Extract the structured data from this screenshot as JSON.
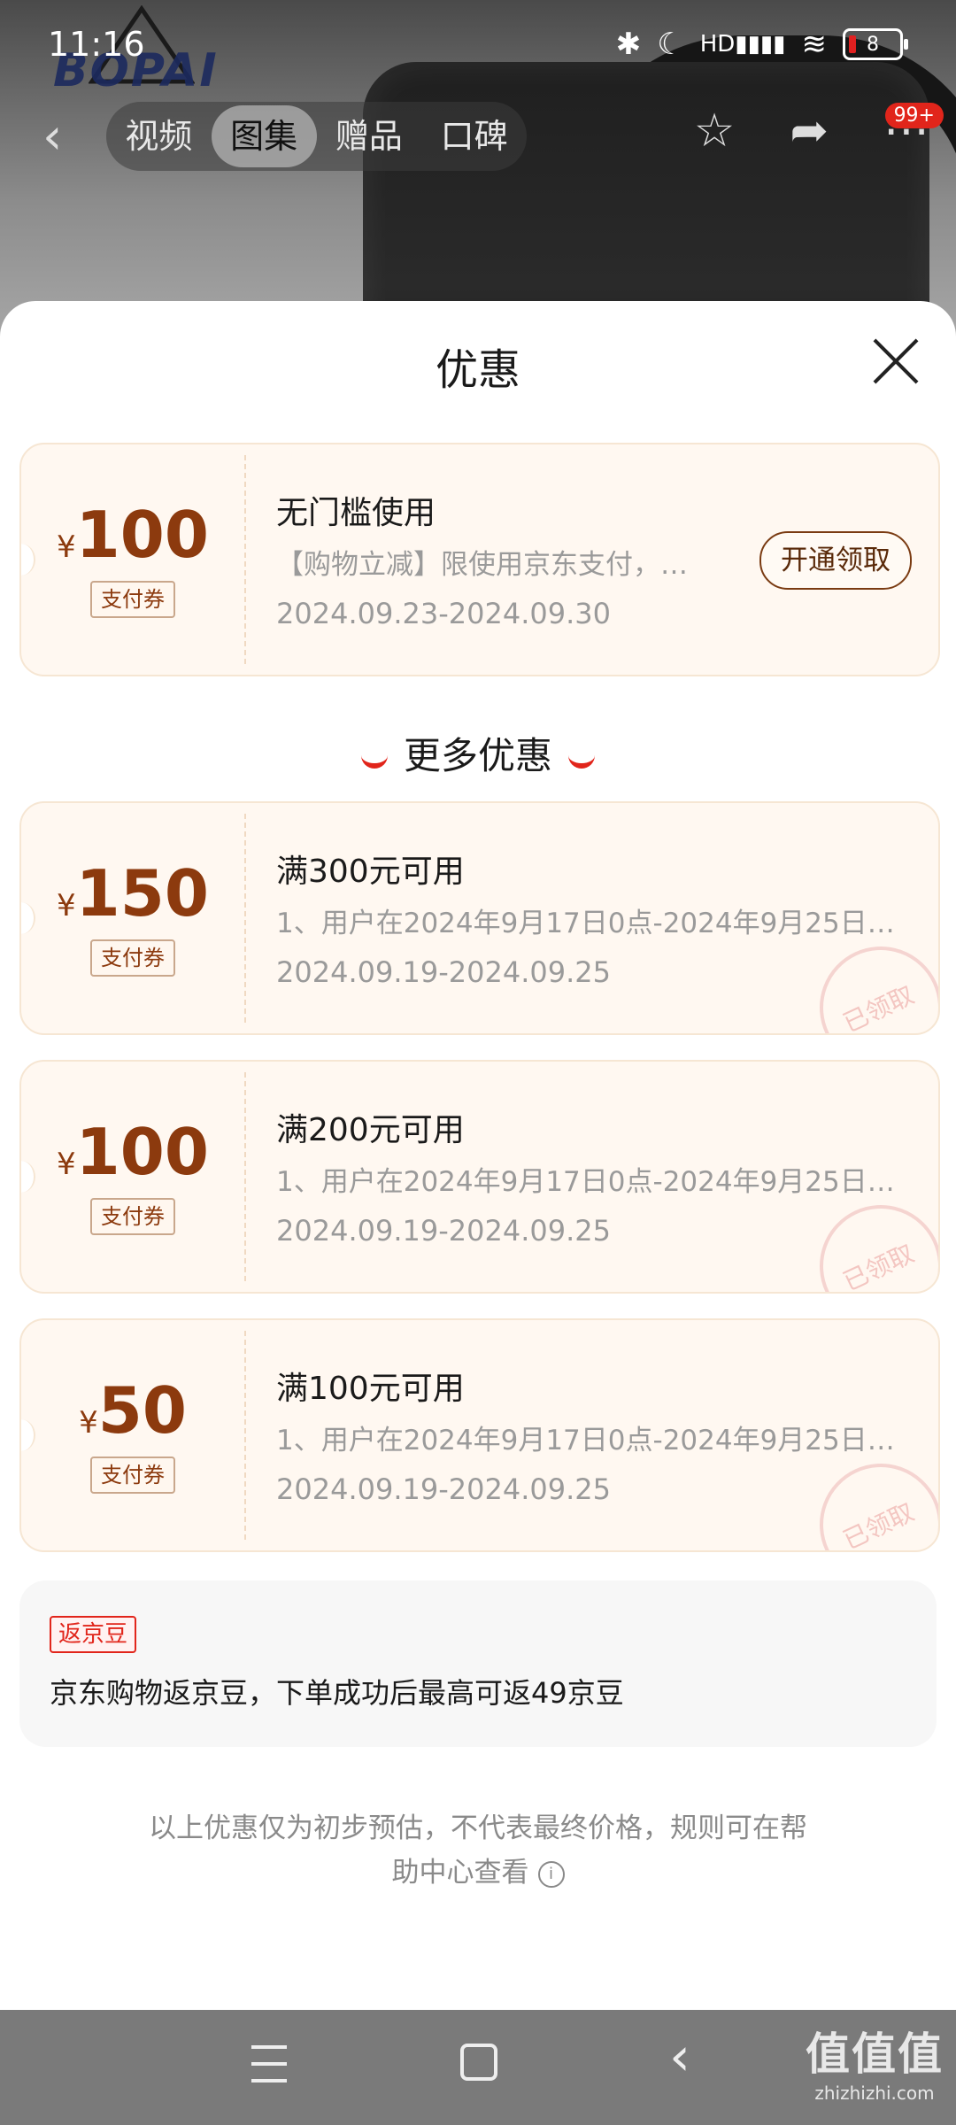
{
  "status_bar": {
    "time": "11:16",
    "battery": "8",
    "icons": [
      "bluetooth-icon",
      "moon-icon",
      "hd-signal-icon",
      "wifi-icon",
      "battery-icon"
    ]
  },
  "header": {
    "brand": "BOPAI",
    "tabs": [
      {
        "label": "视频",
        "active": false
      },
      {
        "label": "图集",
        "active": true
      },
      {
        "label": "赠品",
        "active": false
      },
      {
        "label": "口碑",
        "active": false
      }
    ],
    "badge": "99+"
  },
  "sheet": {
    "title": "优惠",
    "main_coupon": {
      "currency": "¥",
      "amount": "100",
      "tag": "支付券",
      "title": "无门槛使用",
      "desc": "【购物立减】限使用京东支付，…",
      "date": "2024.09.23-2024.09.30",
      "action": "开通领取"
    },
    "more_heading": "更多优惠",
    "coupons": [
      {
        "currency": "¥",
        "amount": "150",
        "tag": "支付券",
        "title": "满300元可用",
        "desc": "1、用户在2024年9月17日0点-2024年9月25日…",
        "date": "2024.09.19-2024.09.25",
        "stamp": "已领取"
      },
      {
        "currency": "¥",
        "amount": "100",
        "tag": "支付券",
        "title": "满200元可用",
        "desc": "1、用户在2024年9月17日0点-2024年9月25日…",
        "date": "2024.09.19-2024.09.25",
        "stamp": "已领取"
      },
      {
        "currency": "¥",
        "amount": "50",
        "tag": "支付券",
        "title": "满100元可用",
        "desc": "1、用户在2024年9月17日0点-2024年9月25日…",
        "date": "2024.09.19-2024.09.25",
        "stamp": "已领取"
      }
    ],
    "beans": {
      "tag": "返京豆",
      "text": "京东购物返京豆，下单成功后最高可返49京豆"
    },
    "footnote_line1": "以上优惠仅为初步预估，不代表最终价格，规则可在帮",
    "footnote_line2": "助中心查看"
  },
  "watermark": {
    "line1": "值值值",
    "line2": "zhizhizhi.com"
  },
  "colors": {
    "accent_red": "#e1251b",
    "coupon_brown": "#8c3a0e",
    "coupon_bg": "#fff8f1"
  }
}
